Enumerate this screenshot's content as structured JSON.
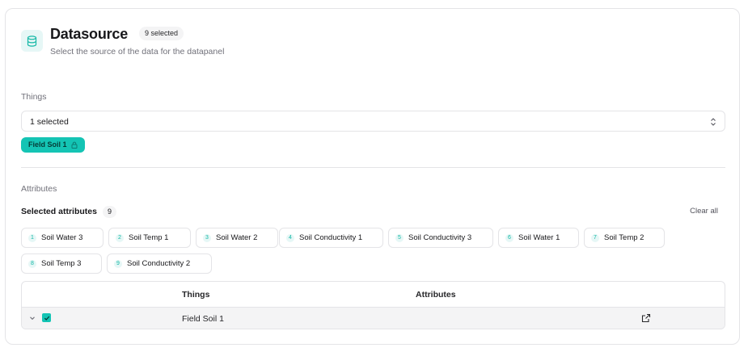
{
  "header": {
    "title": "Datasource",
    "badge": "9 selected",
    "subtitle": "Select the source of the data for the datapanel"
  },
  "things": {
    "label": "Things",
    "select_value": "1 selected",
    "chip_label": "Field Soil 1"
  },
  "attributes": {
    "label": "Attributes",
    "selected_label": "Selected attributes",
    "selected_count": "9",
    "clear_all": "Clear all",
    "items": [
      {
        "num": "1",
        "name": "Soil Water 3"
      },
      {
        "num": "2",
        "name": "Soil Temp 1"
      },
      {
        "num": "3",
        "name": "Soil Water 2"
      },
      {
        "num": "4",
        "name": "Soil Conductivity 1"
      },
      {
        "num": "5",
        "name": "Soil Conductivity 3"
      },
      {
        "num": "6",
        "name": "Soil Water 1"
      },
      {
        "num": "7",
        "name": "Soil Temp 2"
      },
      {
        "num": "8",
        "name": "Soil Temp 3"
      },
      {
        "num": "9",
        "name": "Soil Conductivity 2"
      }
    ]
  },
  "table": {
    "columns": [
      "Things",
      "Attributes"
    ],
    "rows": [
      {
        "thing": "Field Soil 1"
      }
    ]
  },
  "colors": {
    "accent": "#14c4b4",
    "accent_light": "#e6f7f6",
    "border": "#e4e4e7"
  }
}
